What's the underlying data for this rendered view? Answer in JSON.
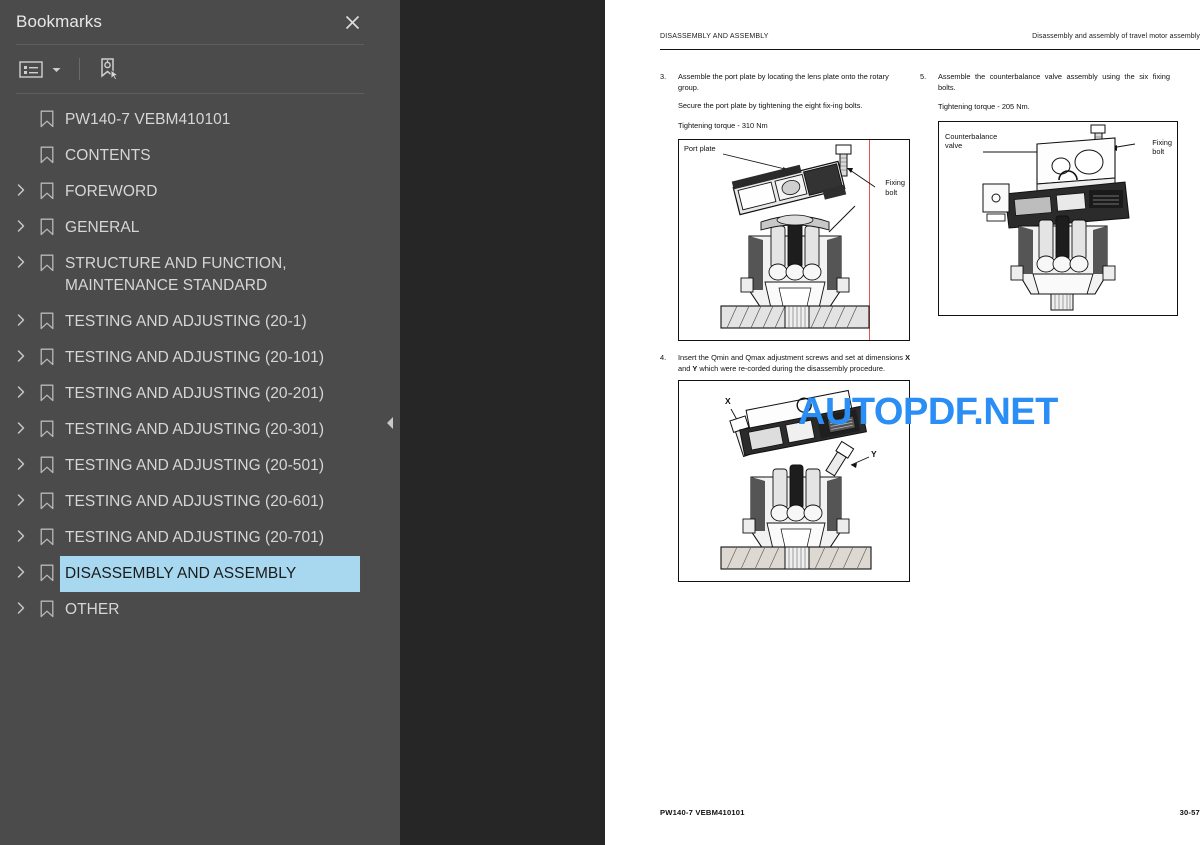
{
  "sidebar": {
    "panel_title": "Bookmarks",
    "close_icon": "close-icon",
    "toolbar": {
      "options_icon": "list-options-icon",
      "options_caret_icon": "chevron-down-icon",
      "new_bookmark_icon": "new-bookmark-icon"
    },
    "collapse_icon": "chevron-left-icon",
    "bookmarks": [
      {
        "label": "PW140-7   VEBM410101",
        "expandable": false,
        "selected": false
      },
      {
        "label": "CONTENTS",
        "expandable": false,
        "selected": false
      },
      {
        "label": "FOREWORD",
        "expandable": true,
        "selected": false
      },
      {
        "label": "GENERAL",
        "expandable": true,
        "selected": false
      },
      {
        "label": "STRUCTURE AND FUNCTION,\nMAINTENANCE STANDARD",
        "expandable": true,
        "selected": false
      },
      {
        "label": "TESTING AND ADJUSTING (20-1)",
        "expandable": true,
        "selected": false
      },
      {
        "label": "TESTING AND ADJUSTING (20-101)",
        "expandable": true,
        "selected": false
      },
      {
        "label": "TESTING AND ADJUSTING (20-201)",
        "expandable": true,
        "selected": false
      },
      {
        "label": "TESTING AND ADJUSTING (20-301)",
        "expandable": true,
        "selected": false
      },
      {
        "label": "TESTING AND ADJUSTING (20-501)",
        "expandable": true,
        "selected": false
      },
      {
        "label": "TESTING AND ADJUSTING (20-601)",
        "expandable": true,
        "selected": false
      },
      {
        "label": "TESTING AND ADJUSTING (20-701)",
        "expandable": true,
        "selected": false
      },
      {
        "label": "DISASSEMBLY AND ASSEMBLY",
        "expandable": true,
        "selected": true
      },
      {
        "label": "OTHER",
        "expandable": true,
        "selected": false
      }
    ]
  },
  "watermark": {
    "text": "AUTOPDF.NET",
    "color": "#2b8ef5"
  },
  "page": {
    "header_left": "DISASSEMBLY AND ASSEMBLY",
    "header_right": "Disassembly and assembly of travel motor assembly",
    "footer_left": "PW140-7   VEBM410101",
    "footer_right": "30-57",
    "steps": [
      {
        "number": "3.",
        "paragraphs": [
          "Assemble the port plate by locating the lens plate onto the rotary group.",
          "Secure the port plate by tightening the eight fix-ing bolts.",
          "Tightening torque - 310 Nm"
        ]
      },
      {
        "number": "4.",
        "paragraphs": [
          "Insert the Qmin and Qmax adjustment screws and set at dimensions X and Y which were re-corded during the disassembly procedure."
        ]
      },
      {
        "number": "5.",
        "paragraphs": [
          "Assemble the counterbalance valve assembly using the six fixing bolts.",
          "Tightening torque - 205 Nm."
        ]
      }
    ],
    "figures": [
      {
        "id": "figure-port-plate",
        "callouts": [
          "Port plate",
          "Fixing\nbolt"
        ],
        "has_red_line": true
      },
      {
        "id": "figure-counterbalance-valve",
        "callouts": [
          "Counterbalance\nvalve",
          "Fixing\nbolt"
        ],
        "has_red_line": false
      },
      {
        "id": "figure-adjustment-screws",
        "callouts": [
          "X",
          "Y"
        ],
        "has_red_line": false
      }
    ]
  }
}
